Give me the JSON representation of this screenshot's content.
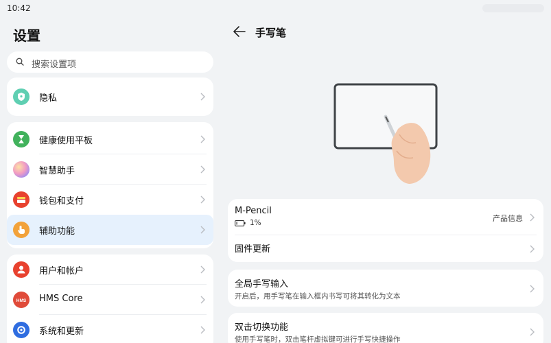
{
  "status": {
    "time": "10:42"
  },
  "settings": {
    "title": "设置",
    "search_placeholder": "搜索设置项",
    "items": [
      {
        "label": "隐私",
        "icon": "shield-icon",
        "color": "#5fcfb2"
      },
      {
        "label": "健康使用平板",
        "icon": "hourglass-icon",
        "color": "#41b25c"
      },
      {
        "label": "智慧助手",
        "icon": "assistant-orb-icon",
        "color": "#c18be6"
      },
      {
        "label": "钱包和支付",
        "icon": "wallet-icon",
        "color": "#e8422f"
      },
      {
        "label": "辅助功能",
        "icon": "hand-pointer-icon",
        "color": "#f2a23a"
      },
      {
        "label": "用户和帐户",
        "icon": "user-icon",
        "color": "#e8422f"
      },
      {
        "label": "HMS Core",
        "icon": "hms-icon",
        "color": "#e04b3a",
        "icon_text": "HMS"
      },
      {
        "label": "系统和更新",
        "icon": "system-update-icon",
        "color": "#2f6de0"
      }
    ]
  },
  "stylus": {
    "title": "手写笔",
    "device_name": "M-Pencil",
    "battery": "1%",
    "product_info": "产品信息",
    "firmware_update": "固件更新",
    "global_handwriting_title": "全局手写输入",
    "global_handwriting_desc": "开启后，用手写笔在输入框内书写可将其转化为文本",
    "double_tap_title": "双击切换功能",
    "double_tap_desc": "使用手写笔时，双击笔杆虚拟键可进行手写快捷操作"
  }
}
